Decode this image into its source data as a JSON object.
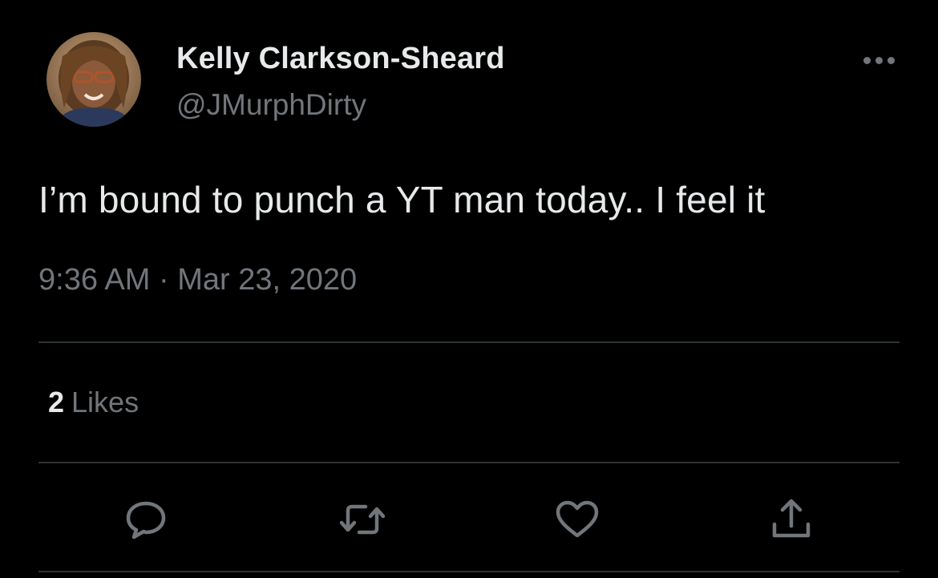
{
  "tweet": {
    "author": {
      "display_name": "Kelly Clarkson-Sheard",
      "handle": "@JMurphDirty",
      "avatar_icon": "profile-photo"
    },
    "text": "I’m bound to punch a YT man today.. I feel it",
    "timestamp": "9:36 AM · Mar 23, 2020",
    "stats": {
      "likes_count": "2",
      "likes_label": "Likes"
    },
    "actions": [
      "reply-icon",
      "retweet-icon",
      "like-icon",
      "share-icon"
    ],
    "more_icon": "more-options-icon"
  },
  "theme": {
    "background": "#000000",
    "text_primary": "#e7e9ea",
    "text_secondary": "#71767b",
    "divider": "#2f3336"
  }
}
